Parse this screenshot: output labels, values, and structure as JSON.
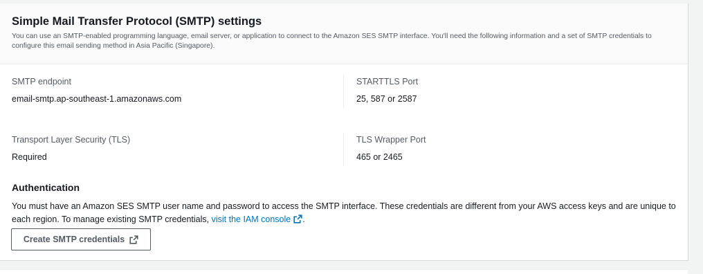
{
  "smtp_settings": {
    "title": "Simple Mail Transfer Protocol (SMTP) settings",
    "description": "You can use an SMTP-enabled programming language, email server, or application to connect to the Amazon SES SMTP interface. You'll need the following information and a set of SMTP credentials to configure this email sending method in Asia Pacific (Singapore).",
    "fields": {
      "endpoint": {
        "label": "SMTP endpoint",
        "value": "email-smtp.ap-southeast-1.amazonaws.com"
      },
      "starttls": {
        "label": "STARTTLS Port",
        "value": "25, 587 or 2587"
      },
      "tls": {
        "label": "Transport Layer Security (TLS)",
        "value": "Required"
      },
      "tls_wrapper": {
        "label": "TLS Wrapper Port",
        "value": "465 or 2465"
      }
    }
  },
  "authentication": {
    "title": "Authentication",
    "text_before_link": "You must have an Amazon SES SMTP user name and password to access the SMTP interface. These credentials are different from your AWS access keys and are unique to each region. To manage existing SMTP credentials, ",
    "link_label": "visit the IAM console",
    "text_after_link": ".",
    "button_label": "Create SMTP credentials"
  },
  "icons": {
    "external_link": "external-link-icon"
  },
  "colors": {
    "link": "#0073bb",
    "heading": "#16191f",
    "label": "#545b64",
    "header_bg": "#fafafa",
    "page_bg": "#f2f3f3"
  }
}
